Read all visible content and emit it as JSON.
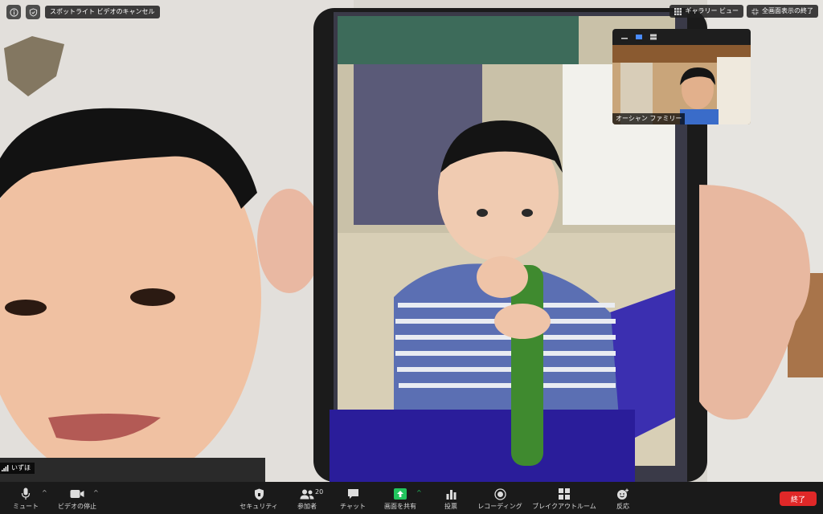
{
  "topbar": {
    "spotlight_cancel": "スポットライト ビデオのキャンセル",
    "gallery_view": "ギャラリー ビュー",
    "exit_fullscreen": "全画面表示の終了"
  },
  "thumbnail": {
    "name": "オーシャン ファミリー"
  },
  "self_view": {
    "name": "いずほ"
  },
  "toolbar": {
    "mute": "ミュート",
    "stop_video": "ビデオの停止",
    "security": "セキュリティ",
    "participants": "参加者",
    "participant_count": "20",
    "chat": "チャット",
    "share_screen": "画面を共有",
    "polling": "投票",
    "recording": "レコーディング",
    "breakout_rooms": "ブレイクアウトルーム",
    "reactions": "反応",
    "end": "終了"
  },
  "colors": {
    "share_green": "#22c55e",
    "end_red": "#e02828",
    "toolbar_bg": "#1a1a1a",
    "accent_blue": "#4a8cff"
  }
}
